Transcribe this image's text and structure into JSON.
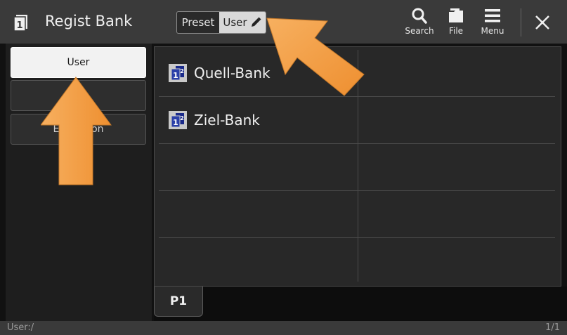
{
  "window": {
    "title": "Regist Bank",
    "icon": "regist-bank-icon"
  },
  "toggle": {
    "preset_label": "Preset",
    "user_label": "User",
    "selected": "User",
    "edit_icon": "pencil-icon"
  },
  "toolbar": {
    "search_label": "Search",
    "file_label": "File",
    "menu_label": "Menu",
    "close_icon": "close-icon"
  },
  "sidebar": {
    "items": [
      {
        "label": "User",
        "active": true
      },
      {
        "label": "",
        "active": false
      },
      {
        "label": "Expansion",
        "active": false
      }
    ]
  },
  "files": {
    "items": [
      {
        "label": "Quell-Bank",
        "icon": "regist-bank-file-icon"
      },
      {
        "label": "Ziel-Bank",
        "icon": "regist-bank-file-icon"
      }
    ]
  },
  "tabs": {
    "pages": [
      "P1"
    ]
  },
  "status": {
    "path": "User:/",
    "page": "1/1"
  },
  "colors": {
    "accent_arrow": "#f5a04a",
    "background": "#111111",
    "titlebar": "#3a3a3a"
  }
}
